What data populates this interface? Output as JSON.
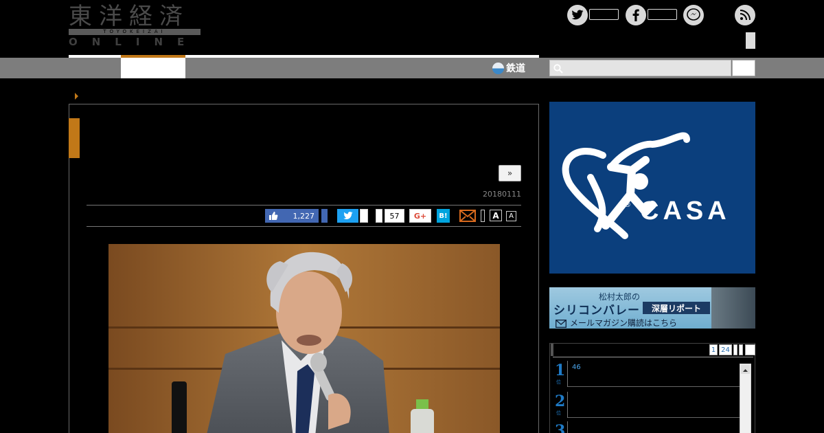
{
  "header": {
    "logo_kanji": "東洋経済",
    "logo_roman": "TOYOKEIZAI",
    "logo_online": "ONLINE"
  },
  "social_icons": [
    "twitter-icon",
    "facebook-icon",
    "messenger-icon",
    "rss-icon"
  ],
  "nav": {
    "rail_label": "鉄道"
  },
  "article": {
    "next_button": "»",
    "date": "20180111",
    "share": {
      "fb_like_count": "1,227",
      "pocket_count": "57",
      "gplus_label": "G+",
      "hatena_label": "B!",
      "font_large": "A",
      "font_small": "A"
    }
  },
  "sidebar": {
    "casa_ad": {
      "word": "CASA",
      "reg": "®"
    },
    "mailmag_banner": {
      "author_line": "松村太郎の",
      "title": "シリコンバレー",
      "badge": "深層リポート",
      "link": "メールマガジン購読はこちら"
    },
    "ranking": {
      "tabs": [
        "1",
        "24"
      ],
      "views_label": "46",
      "items": [
        {
          "rank": "1",
          "unit": "位"
        },
        {
          "rank": "2",
          "unit": "位"
        },
        {
          "rank": "3",
          "unit": "位"
        }
      ]
    }
  },
  "colors": {
    "accent_orange": "#c17818",
    "nav_gray": "#7d7d7d",
    "casa_blue": "#0b3f7d",
    "facebook_blue": "#4267b2",
    "twitter_blue": "#1da1f2",
    "hatena_blue": "#00a4de",
    "rank_blue": "#1f7bc7"
  }
}
